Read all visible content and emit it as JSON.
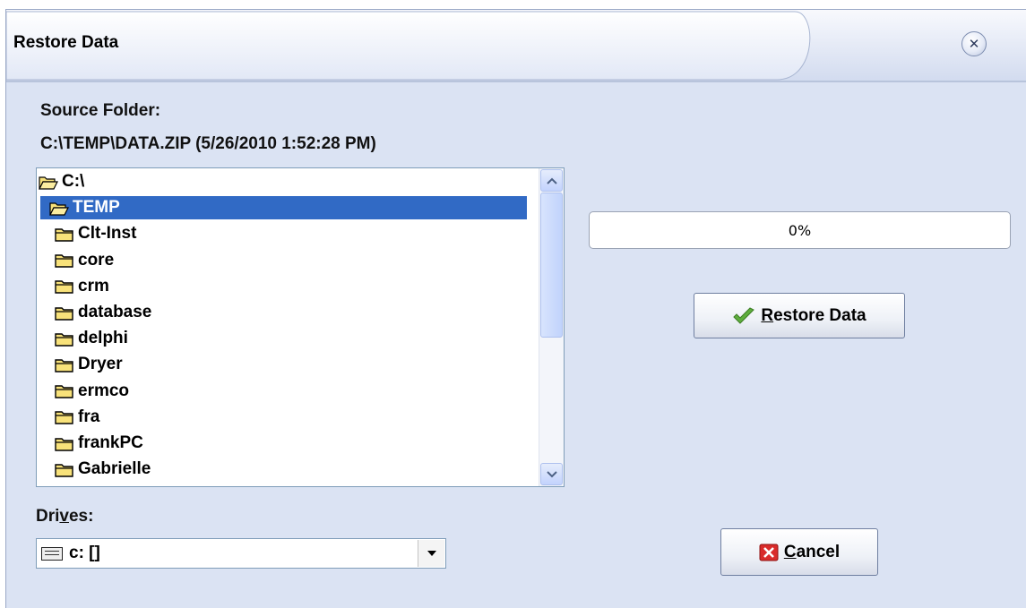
{
  "window": {
    "title": "Restore Data",
    "close_icon": "close-icon"
  },
  "source": {
    "label": "Source Folder:",
    "path": "C:\\TEMP\\DATA.ZIP (5/26/2010 1:52:28 PM)"
  },
  "folders": {
    "items": [
      {
        "label": "C:\\",
        "state": "open",
        "selected": false,
        "indent": 0
      },
      {
        "label": "TEMP",
        "state": "open",
        "selected": true,
        "indent": 1
      },
      {
        "label": "Clt-Inst",
        "state": "closed",
        "selected": false,
        "indent": 2
      },
      {
        "label": "core",
        "state": "closed",
        "selected": false,
        "indent": 2
      },
      {
        "label": "crm",
        "state": "closed",
        "selected": false,
        "indent": 2
      },
      {
        "label": "database",
        "state": "closed",
        "selected": false,
        "indent": 2
      },
      {
        "label": "delphi",
        "state": "closed",
        "selected": false,
        "indent": 2
      },
      {
        "label": "Dryer",
        "state": "closed",
        "selected": false,
        "indent": 2
      },
      {
        "label": "ermco",
        "state": "closed",
        "selected": false,
        "indent": 2
      },
      {
        "label": "fra",
        "state": "closed",
        "selected": false,
        "indent": 2
      },
      {
        "label": "frankPC",
        "state": "closed",
        "selected": false,
        "indent": 2
      },
      {
        "label": "Gabrielle",
        "state": "closed",
        "selected": false,
        "indent": 2
      }
    ]
  },
  "progress": {
    "value": 0,
    "text": "0%"
  },
  "buttons": {
    "restore": {
      "accel": "R",
      "rest": "estore Data",
      "icon": "checkmark-icon"
    },
    "cancel": {
      "accel": "C",
      "rest": "ancel",
      "icon": "red-x-icon"
    }
  },
  "drives": {
    "label_pre": "Dri",
    "label_accel": "v",
    "label_post": "es:",
    "value": "c: []",
    "icon": "hard-drive-icon"
  },
  "colors": {
    "dialog_bg": "#dbe3f3",
    "selection": "#316ac5",
    "folder_yellow": "#f8e27a"
  }
}
